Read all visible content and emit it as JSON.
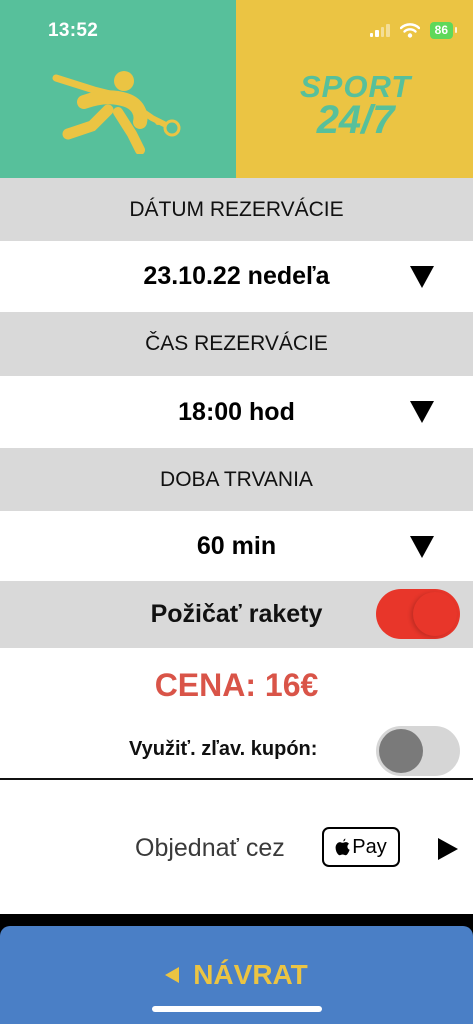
{
  "status_bar": {
    "time": "13:52",
    "battery": "86"
  },
  "logo": {
    "line1": "SPORT",
    "line2": "24/7"
  },
  "date_section": {
    "label": "DÁTUM REZERVÁCIE",
    "value": "23.10.22 nedeľa"
  },
  "time_section": {
    "label": "ČAS REZERVÁCIE",
    "value": "18:00 hod"
  },
  "duration_section": {
    "label": "DOBA TRVANIA",
    "value": "60 min"
  },
  "rackets": {
    "label": "Požičať rakety",
    "enabled": true
  },
  "price": {
    "text": "CENA: 16€"
  },
  "coupon": {
    "label": "Využiť. zľav. kupón:",
    "enabled": false
  },
  "order": {
    "label": "Objednať cez",
    "pay_text": "Pay"
  },
  "back_button": {
    "label": "NÁVRAT"
  },
  "colors": {
    "green": "#57C09B",
    "yellow": "#EBC443",
    "gray_row": "#D9D9D9",
    "price_red": "#D95448",
    "toggle_on": "#E8362A",
    "toggle_off": "#D6D6D6",
    "back_blue": "#4A7FC6"
  }
}
